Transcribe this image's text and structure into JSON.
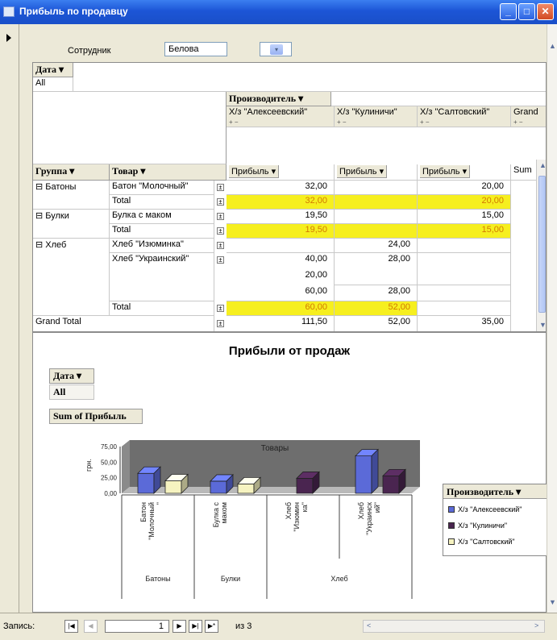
{
  "window": {
    "title": "Прибыль по продавцу",
    "min": "_",
    "max": "□",
    "close": "✕"
  },
  "form": {
    "employee_label": "Сотрудник",
    "employee_value": "Белова",
    "dropdown_glyph": "▾"
  },
  "pivot": {
    "filter_field": "Дата ▾",
    "filter_value": "All",
    "column_field": "Производитель ▾",
    "group_field": "Группа ▾",
    "item_field": "Товар ▾",
    "grand_total_col": "Grand",
    "sum_label": "Sum",
    "columns": [
      {
        "name": "Х/з \"Алексеевский\"",
        "data_field": "Прибыль ▾"
      },
      {
        "name": "Х/з \"Кулиничи\"",
        "data_field": "Прибыль ▾"
      },
      {
        "name": "Х/з \"Салтовский\"",
        "data_field": "Прибыль ▾"
      }
    ],
    "plus_minus": "+ −",
    "groups": {
      "batony": "⊟ Батоны",
      "bulki": "⊟ Булки",
      "hleb": "⊟ Хлеб"
    },
    "items": {
      "baton_mol": "Батон \"Молочный\"",
      "bulka_mak": "Булка с маком",
      "hleb_izum": "Хлеб \"Изюминка\"",
      "hleb_ukr": "Хлеб \"Украинский\"",
      "total": "Total"
    },
    "values": {
      "baton_a": "32,00",
      "baton_s": "20,00",
      "baton_tot_a": "32,00",
      "baton_tot_s": "20,00",
      "bulka_a": "19,50",
      "bulka_s": "15,00",
      "bulka_tot_a": "19,50",
      "bulka_tot_s": "15,00",
      "izum_k": "24,00",
      "ukr_a1": "40,00",
      "ukr_k1": "28,00",
      "ukr_a2": "20,00",
      "ukr_a3": "60,00",
      "ukr_k3": "28,00",
      "hleb_tot_a": "60,00",
      "hleb_tot_k": "52,00",
      "grand_a": "111,50",
      "grand_k": "52,00",
      "grand_s": "35,00"
    },
    "grand_total_label": "Grand Total"
  },
  "chart": {
    "title": "Прибыли от продаж",
    "filter_field": "Дата ▾",
    "filter_value": "All",
    "data_field": "Sum of Прибыль",
    "category_field": "Товары",
    "legend_field": "Производитель ▾",
    "legend": [
      {
        "name": "Х/з \"Алексеевский\"",
        "color": "#5b6ad8"
      },
      {
        "name": "Х/з \"Кулиничи\"",
        "color": "#4a2550"
      },
      {
        "name": "Х/з \"Салтовский\"",
        "color": "#f6f3c0"
      }
    ]
  },
  "chart_data": {
    "type": "bar",
    "title": "Прибыли от продаж",
    "ylabel": "грн.",
    "xlabel": "Товары",
    "ylim": [
      0,
      75
    ],
    "yticks": [
      "75,00",
      "50,00",
      "25,00",
      "0,00"
    ],
    "categories": [
      "Батон \"Молочный\"",
      "Булка с маком",
      "Хлеб \"Изюмин ка\"",
      "Хлеб \"Украинск ий\""
    ],
    "category_labels": [
      [
        "Батон",
        "\"Молочный",
        "\""
      ],
      [
        "Булка с",
        "маком"
      ],
      [
        "Хлеб",
        "\"Изюмин",
        "ка\""
      ],
      [
        "Хлеб",
        "\"Украинск",
        "ий\""
      ]
    ],
    "groups": [
      "Батоны",
      "Булки",
      "Хлеб"
    ],
    "series": [
      {
        "name": "Х/з \"Алексеевский\"",
        "values": [
          32,
          19.5,
          null,
          60
        ]
      },
      {
        "name": "Х/з \"Кулиничи\"",
        "values": [
          null,
          null,
          24,
          28
        ]
      },
      {
        "name": "Х/з \"Салтовский\"",
        "values": [
          20,
          15,
          null,
          null
        ]
      }
    ],
    "grid": false,
    "legend_position": "right"
  },
  "statusbar": {
    "label": "Запись:",
    "first": "|◀",
    "prev": "◀",
    "record": "1",
    "next": "▶",
    "last": "▶|",
    "new": "▶*",
    "of_text": "из 3",
    "left_arrow": "<",
    "right_arrow": ">"
  }
}
